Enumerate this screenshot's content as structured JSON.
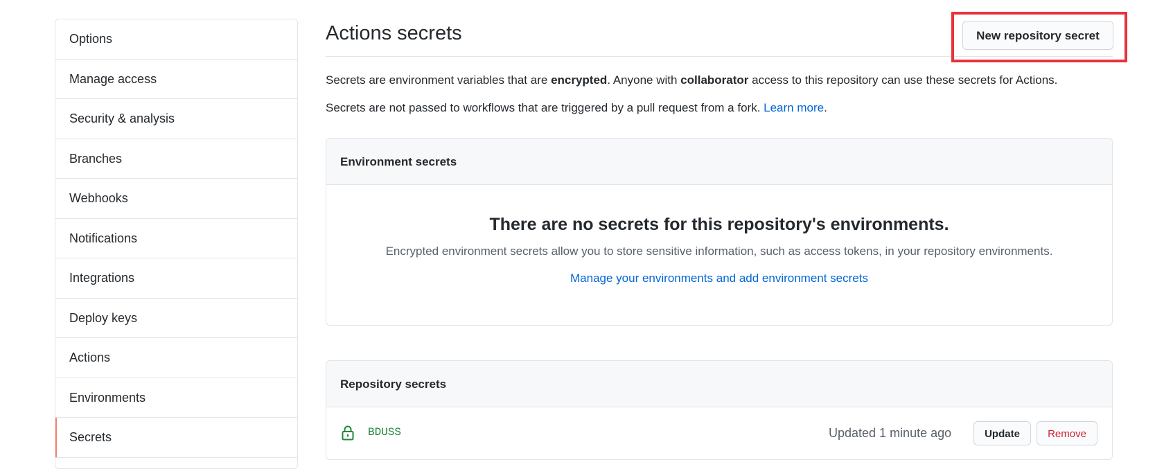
{
  "sidebar": {
    "items": [
      {
        "label": "Options"
      },
      {
        "label": "Manage access"
      },
      {
        "label": "Security & analysis"
      },
      {
        "label": "Branches"
      },
      {
        "label": "Webhooks"
      },
      {
        "label": "Notifications"
      },
      {
        "label": "Integrations"
      },
      {
        "label": "Deploy keys"
      },
      {
        "label": "Actions"
      },
      {
        "label": "Environments"
      },
      {
        "label": "Secrets"
      }
    ],
    "selected": "Secrets"
  },
  "header": {
    "title": "Actions secrets",
    "new_secret_label": "New repository secret"
  },
  "description": {
    "line1_pre": "Secrets are environment variables that are ",
    "line1_bold1": "encrypted",
    "line1_mid": ". Anyone with ",
    "line1_bold2": "collaborator",
    "line1_post": " access to this repository can use these secrets for Actions.",
    "line2_pre": "Secrets are not passed to workflows that are triggered by a pull request from a fork. ",
    "line2_link": "Learn more",
    "line2_post": "."
  },
  "environment_secrets": {
    "header": "Environment secrets",
    "blank_title": "There are no secrets for this repository's environments.",
    "blank_desc": "Encrypted environment secrets allow you to store sensitive information, such as access tokens, in your repository environments.",
    "blank_link": "Manage your environments and add environment secrets"
  },
  "repository_secrets": {
    "header": "Repository secrets",
    "rows": [
      {
        "icon": "lock-icon",
        "name": "BDUSS",
        "updated": "Updated 1 minute ago",
        "update_label": "Update",
        "remove_label": "Remove"
      }
    ]
  },
  "colors": {
    "accent_selected": "#f9826c",
    "link": "#0366d6",
    "secret_name": "#22863a",
    "danger": "#cb2431",
    "highlight": "#e8323c"
  }
}
